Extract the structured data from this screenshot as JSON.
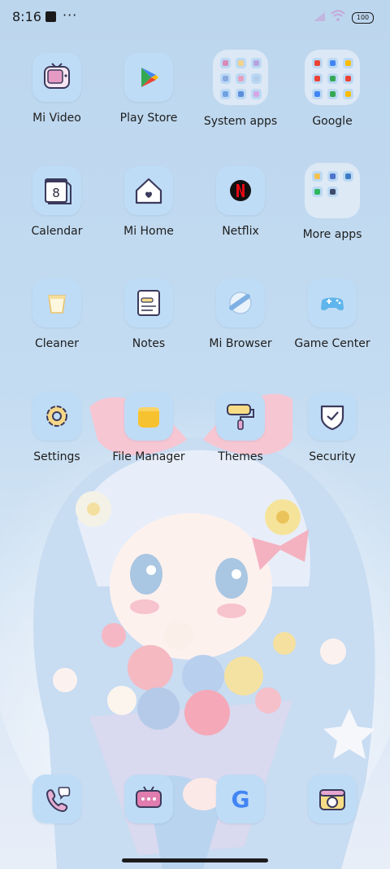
{
  "status_bar": {
    "time": "8:16",
    "overflow": "···",
    "battery": "100"
  },
  "apps": {
    "mi_video": "Mi Video",
    "play_store": "Play Store",
    "system_apps": "System apps",
    "google": "Google",
    "calendar": "Calendar",
    "calendar_day": "8",
    "mi_home": "Mi Home",
    "netflix": "Netflix",
    "more_apps": "More apps",
    "cleaner": "Cleaner",
    "notes": "Notes",
    "mi_browser": "Mi Browser",
    "game_center": "Game Center",
    "settings": "Settings",
    "file_manager": "File Manager",
    "themes": "Themes",
    "security": "Security"
  },
  "dock": {
    "google_glyph": "G"
  },
  "colors": {
    "icon_bg": "#bfdcf6",
    "text": "#1d1d1d",
    "netflix_red": "#e50914"
  }
}
